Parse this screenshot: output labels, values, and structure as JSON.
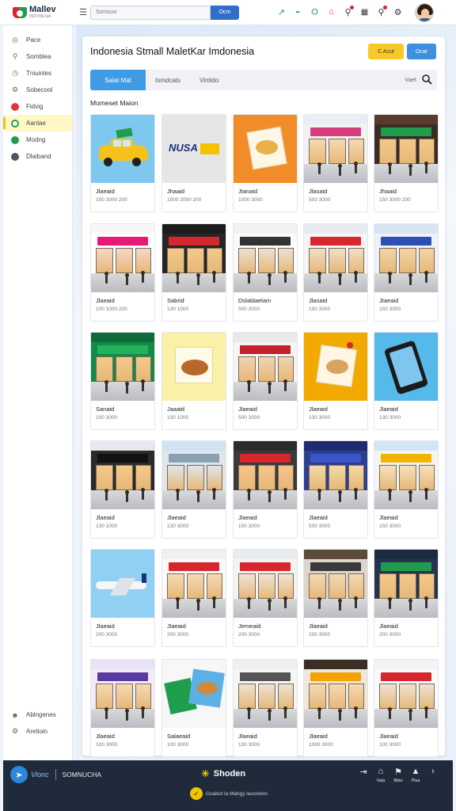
{
  "header": {
    "logo_name": "Mallev",
    "logo_sub": "INDONESIA",
    "search_placeholder": "Ssmscio",
    "search_button": "Ocm"
  },
  "sidebar": {
    "items": [
      {
        "label": "Pace",
        "icon": "target-icon"
      },
      {
        "label": "Somblea",
        "icon": "search-icon"
      },
      {
        "label": "Tniuinles",
        "icon": "clock-icon"
      },
      {
        "label": "Sobecool",
        "icon": "gear-icon"
      },
      {
        "label": "Fidvig",
        "icon": "red-dot-icon"
      },
      {
        "label": "Aanlae",
        "icon": "green-circle-icon",
        "active": true
      },
      {
        "label": "Modng",
        "icon": "green-dot-icon"
      },
      {
        "label": "Dlaiband",
        "icon": "dark-dot-icon"
      }
    ],
    "bottom_items": [
      {
        "label": "Ablngenes",
        "icon": "people-icon"
      },
      {
        "label": "Aretioin",
        "icon": "gear-icon"
      }
    ]
  },
  "main": {
    "title": "Indonesia Stmall MaletKar Imdonesia",
    "btn_primary": "C Acut",
    "btn_secondary": "Ocar",
    "tabs": [
      "Saiat Mat",
      "Ismdcats",
      "Vintido"
    ],
    "tab_right": "Vaet",
    "section_label": "Momeset Maion"
  },
  "cards": [
    {
      "name": "Jlaeaid",
      "meta": "100  3000  200",
      "thumb": "taxi"
    },
    {
      "name": "Jhaaid",
      "meta": "1000  2000  200",
      "thumb": "logo"
    },
    {
      "name": "Jtanaid",
      "meta": "1000  3000",
      "thumb": "food-orange"
    },
    {
      "name": "Jlasaid",
      "meta": "500  3000",
      "thumb": "store-pink"
    },
    {
      "name": "Jhaaid",
      "meta": "150  3000  200",
      "thumb": "store-green"
    },
    {
      "name": "Jlaeaid",
      "meta": "100  1000  200",
      "thumb": "store-magenta"
    },
    {
      "name": "Sabrid",
      "meta": "130  1000",
      "thumb": "store-red-dark"
    },
    {
      "name": "Dslaldaelam",
      "meta": "500  3000",
      "thumb": "store-white"
    },
    {
      "name": "Jlasaid",
      "meta": "150  3000",
      "thumb": "store-red"
    },
    {
      "name": "Jtaeaid",
      "meta": "150  3000",
      "thumb": "store-blue"
    },
    {
      "name": "Sanaid",
      "meta": "100  3000",
      "thumb": "store-emerald"
    },
    {
      "name": "Jaaaid",
      "meta": "100  1000",
      "thumb": "food-yellow"
    },
    {
      "name": "Jlaeaid",
      "meta": "500  3000",
      "thumb": "store-red-white"
    },
    {
      "name": "Jlaeaid",
      "meta": "130  3000",
      "thumb": "food-amber"
    },
    {
      "name": "Jlaeaid",
      "meta": "130  3000",
      "thumb": "phone"
    },
    {
      "name": "Jlaeaid",
      "meta": "130  1000",
      "thumb": "store-dark"
    },
    {
      "name": "Jlaeaid",
      "meta": "130  3000",
      "thumb": "plaza"
    },
    {
      "name": "Jlaeaid",
      "meta": "100  3000",
      "thumb": "store-red-inside"
    },
    {
      "name": "Jlaeaid",
      "meta": "500  3000",
      "thumb": "store-navy"
    },
    {
      "name": "Jlaeaid",
      "meta": "150  3000",
      "thumb": "store-palm"
    },
    {
      "name": "Jlaeaid",
      "meta": "200  3000",
      "thumb": "plane"
    },
    {
      "name": "Jlaeaid",
      "meta": "200  3000",
      "thumb": "store-light"
    },
    {
      "name": "Jemeaid",
      "meta": "200  3000",
      "thumb": "store-white-red"
    },
    {
      "name": "Jlaeaid",
      "meta": "200  3000",
      "thumb": "store-gallery"
    },
    {
      "name": "Jlaeaid",
      "meta": "200  3000",
      "thumb": "store-green-dark"
    },
    {
      "name": "Jlaeaid",
      "meta": "100  3000",
      "thumb": "corridor"
    },
    {
      "name": "Salaeaid",
      "meta": "100  3000",
      "thumb": "cards-food"
    },
    {
      "name": "Jlaeaid",
      "meta": "130  3000",
      "thumb": "store-grey"
    },
    {
      "name": "Jlaeaid",
      "meta": "1000  3000",
      "thumb": "store-orange"
    },
    {
      "name": "Jlaeaid",
      "meta": "100  3000",
      "thumb": "store-bright"
    }
  ],
  "footer": {
    "brand": "Vlonc",
    "section": "SOMNUCHA",
    "center_title": "Shoden",
    "center_sub": "Goabot la Mahgy laoorelon",
    "icons": [
      {
        "label": "",
        "icon": "export-icon"
      },
      {
        "label": "Vata",
        "icon": "home-icon"
      },
      {
        "label": "Bbte",
        "icon": "pin-icon"
      },
      {
        "label": "Ptsa",
        "icon": "filter-icon"
      },
      {
        "label": "",
        "icon": "chevron-right-icon"
      }
    ]
  },
  "colors": {
    "accent": "#3f9be4",
    "brand_red": "#d7262e",
    "brand_green": "#1f9d4d",
    "highlight": "#f7c928",
    "footer_bg": "#1f2b3a"
  }
}
